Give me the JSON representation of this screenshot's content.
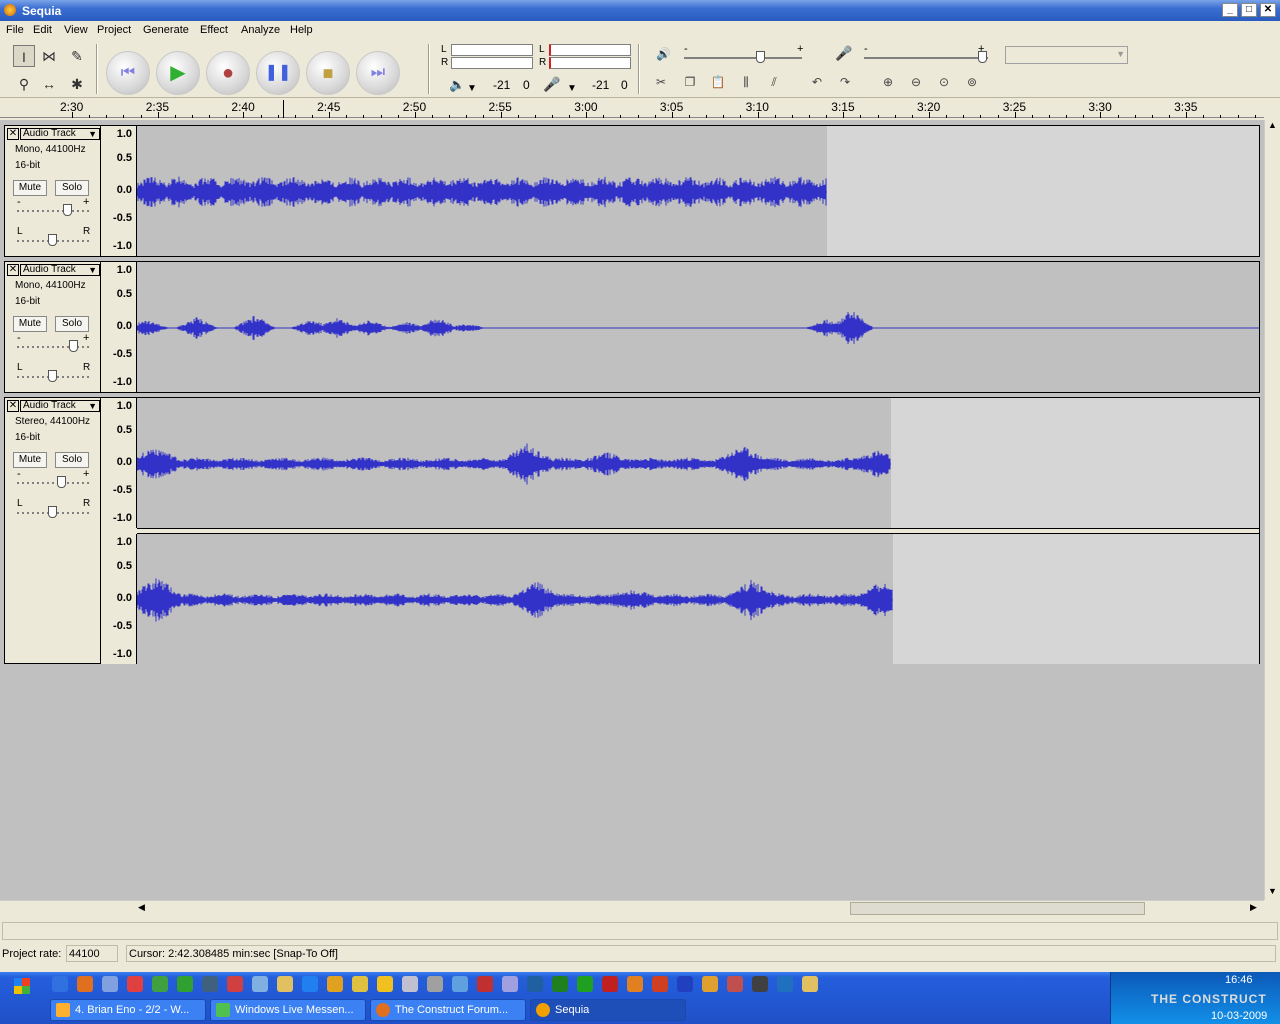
{
  "window": {
    "title": "Sequia",
    "min": "_",
    "max": "□",
    "close": "✕"
  },
  "menu": [
    "File",
    "Edit",
    "View",
    "Project",
    "Generate",
    "Effect",
    "Analyze",
    "Help"
  ],
  "meters": {
    "left": "L",
    "right": "R",
    "play_db": "-21",
    "play_zero": "0",
    "rec_db": "-21",
    "rec_zero": "0"
  },
  "gain": {
    "minus": "-",
    "plus": "+"
  },
  "ruler": [
    "2:30",
    "2:35",
    "2:40",
    "2:45",
    "2:50",
    "2:55",
    "3:00",
    "3:05",
    "3:10",
    "3:15",
    "3:20",
    "3:25",
    "3:30",
    "3:35"
  ],
  "tracks": [
    {
      "name": "Audio Track",
      "info1": "Mono, 44100Hz",
      "info2": "16-bit",
      "mute": "Mute",
      "solo": "Solo"
    },
    {
      "name": "Audio Track",
      "info1": "Mono, 44100Hz",
      "info2": "16-bit",
      "mute": "Mute",
      "solo": "Solo"
    },
    {
      "name": "Audio Track",
      "info1": "Stereo, 44100Hz",
      "info2": "16-bit",
      "mute": "Mute",
      "solo": "Solo"
    }
  ],
  "scale": [
    "1.0",
    "0.5",
    "0.0",
    "-0.5",
    "-1.0"
  ],
  "pan": {
    "l": "L",
    "r": "R"
  },
  "status": {
    "rate_label": "Project rate:",
    "rate_value": "44100",
    "cursor": "Cursor: 2:42.308485 min:sec   [Snap-To Off]"
  },
  "taskbar": {
    "tasks": [
      "4. Brian Eno - 2/2 - W...",
      "Windows Live Messen...",
      "The Construct Forum...",
      "Sequia"
    ],
    "time": "16:46",
    "date": "10-03-2009",
    "tray_text": "THE CONSTRUCT"
  },
  "colors": {
    "waveform": "#3232c8",
    "selection": "#c0c0c0",
    "unselected": "#d6d6d6"
  }
}
